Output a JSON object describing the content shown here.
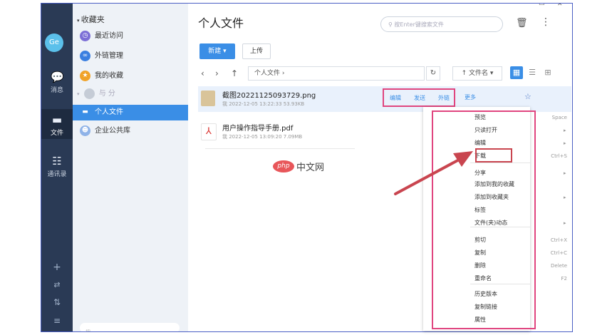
{
  "window": {
    "minimize_glyph": "—",
    "restore_glyph": "□",
    "close_glyph": "✕"
  },
  "rail": {
    "avatar_text": "Ge",
    "items": [
      {
        "label": "消息",
        "icon": "chat-bubble-icon"
      },
      {
        "label": "文件",
        "icon": "folder-icon"
      },
      {
        "label": "通讯录",
        "icon": "contacts-icon"
      }
    ],
    "bottom_icons": [
      "add-icon",
      "transfer-icon",
      "sort-icon",
      "menu-icon"
    ]
  },
  "sidebar": {
    "favorites_header": "收藏夹",
    "favorites": [
      {
        "label": "最近访问",
        "icon": "clock-icon",
        "color": "#7c6fd6"
      },
      {
        "label": "外链管理",
        "icon": "link-icon",
        "color": "#3a7fe0"
      },
      {
        "label": "我的收藏",
        "icon": "star-icon",
        "color": "#f0a32a"
      }
    ],
    "group_header": "与 分",
    "libraries": [
      {
        "label": "个人文件",
        "icon": "folder-icon",
        "active": true
      },
      {
        "label": "企业公共库",
        "icon": "team-icon",
        "active": false
      }
    ],
    "search_placeholder": "搜"
  },
  "main": {
    "title": "个人文件",
    "search_placeholder": "按Enter键搜索文件",
    "new_button": "新建 ▾",
    "upload_button": "上传",
    "breadcrumb": "个人文件  ›",
    "sort_label": "↑ 文件名 ▾",
    "files": [
      {
        "name": "截图20221125093729.png",
        "meta": "我  2022-12-05 13:22:33  53.93KB",
        "actions": [
          "编辑",
          "发送",
          "外链"
        ],
        "more": "更多"
      },
      {
        "name": "用户操作指导手册.pdf",
        "meta": "我  2022-12-05 13:09:20  7.09MB"
      }
    ]
  },
  "context_menu": {
    "items": [
      {
        "label": "预览",
        "shortcut": "Space"
      },
      {
        "label": "只读打开",
        "shortcut": "▸"
      },
      {
        "label": "编辑",
        "shortcut": "▸"
      },
      {
        "label": "下载",
        "shortcut": "Ctrl+S"
      },
      {
        "label": "分享",
        "shortcut": "▸"
      },
      {
        "label": "添加到我的收藏",
        "shortcut": ""
      },
      {
        "label": "添加到收藏夹",
        "shortcut": "▸"
      },
      {
        "label": "标签",
        "shortcut": ""
      },
      {
        "label": "文件(夹)动态",
        "shortcut": "▸"
      },
      {
        "label": "剪切",
        "shortcut": "Ctrl+X"
      },
      {
        "label": "复制",
        "shortcut": "Ctrl+C"
      },
      {
        "label": "删除",
        "shortcut": "Delete"
      },
      {
        "label": "重命名",
        "shortcut": "F2"
      },
      {
        "label": "历史版本",
        "shortcut": ""
      },
      {
        "label": "复制链接",
        "shortcut": ""
      },
      {
        "label": "属性",
        "shortcut": ""
      }
    ]
  },
  "watermark": {
    "logo": "php",
    "text": "中文网"
  },
  "colors": {
    "accent": "#3a8ee6",
    "highlight": "#e0457f",
    "arrow": "#c9454f",
    "rail": "#2a3a55"
  }
}
